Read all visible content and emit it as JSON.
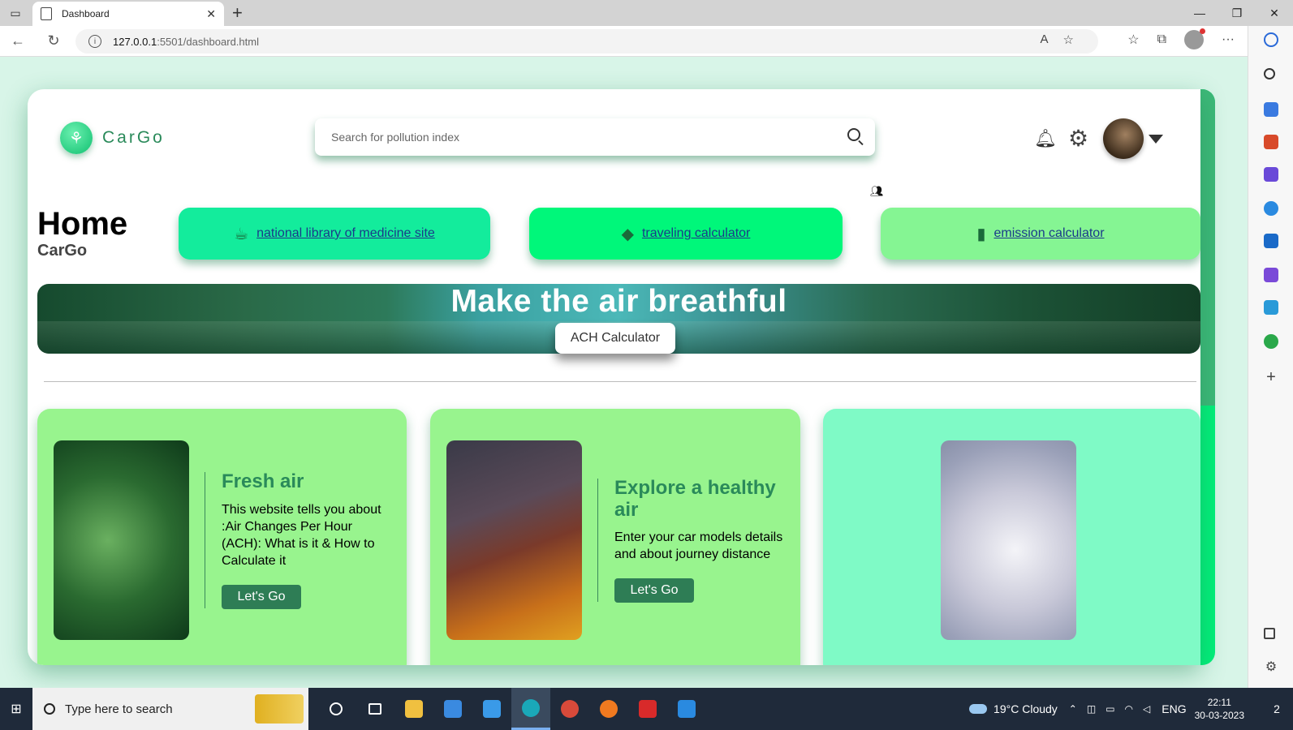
{
  "browser": {
    "tab_title": "Dashboard",
    "url_host": "127.0.0.1",
    "url_path": ":5501/dashboard.html"
  },
  "app": {
    "logo_text": "CarGo",
    "search_placeholder": "Search for pollution index",
    "home_title": "Home",
    "home_subtitle": "CarGo"
  },
  "quick_links": [
    {
      "label": "national library of medicine site",
      "icon": "teapot-icon"
    },
    {
      "label": "traveling calculator",
      "icon": "eraser-icon"
    },
    {
      "label": "emission calculator",
      "icon": "mug-icon"
    }
  ],
  "banner": {
    "title": "Make the air breathful",
    "button_label": "ACH Calculator"
  },
  "feature_cards": [
    {
      "title": "Fresh air",
      "text": "This website tells you about :Air Changes Per Hour (ACH): What is it & How to Calculate it",
      "button": "Let's Go"
    },
    {
      "title": "Explore a healthy air",
      "text": "Enter your car models details and about journey distance",
      "button": "Let's Go"
    }
  ],
  "taskbar": {
    "search_placeholder": "Type here to search",
    "weather": "19°C  Cloudy",
    "language": "ENG",
    "time": "22:11",
    "date": "30-03-2023",
    "notifications": "2"
  },
  "colors": {
    "accent": "#2a8a5a",
    "card_green": "#98f48e",
    "card_aqua": "#7ffac6",
    "link_teal": "#13ec9c",
    "link_green": "#00f77a",
    "link_light": "#85f593"
  }
}
